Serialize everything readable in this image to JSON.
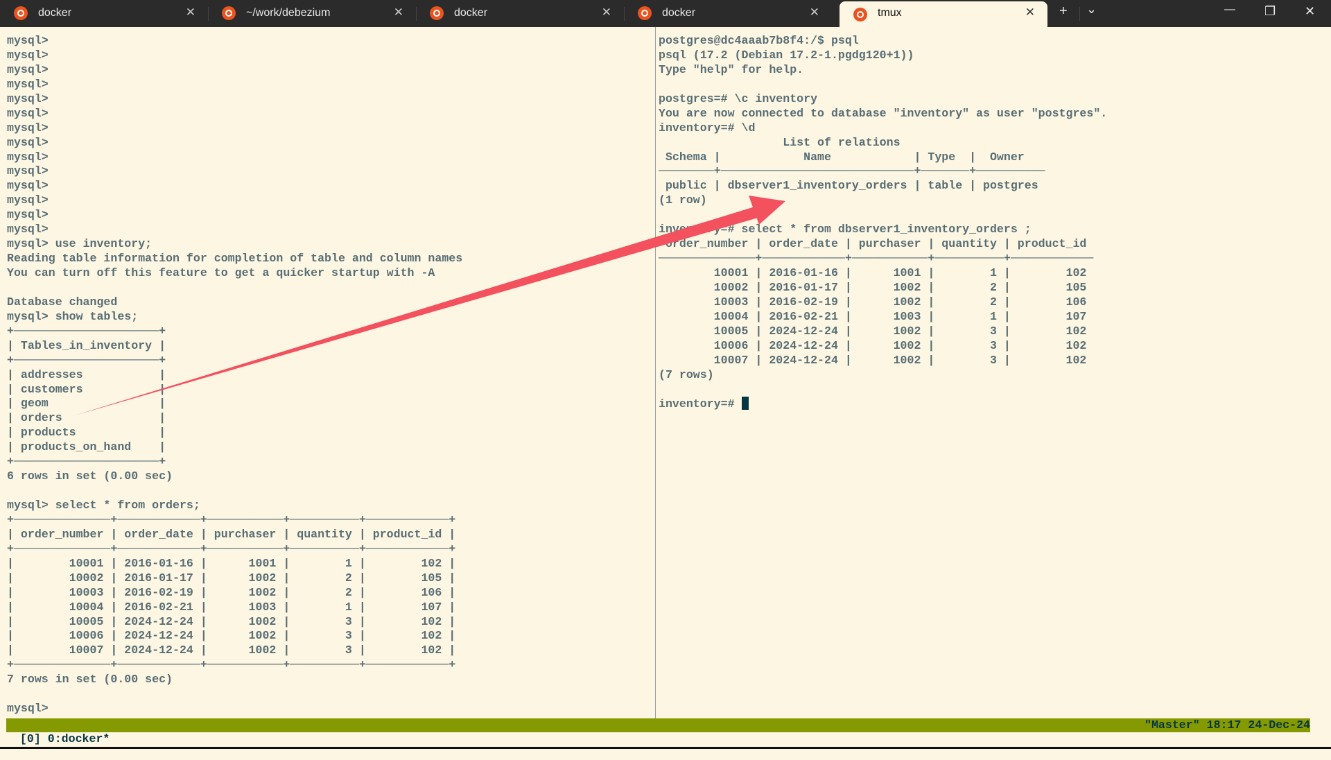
{
  "tabs": [
    {
      "label": "docker",
      "icon": "ubuntu-icon",
      "active": false
    },
    {
      "label": "~/work/debezium",
      "icon": "ubuntu-icon",
      "active": false
    },
    {
      "label": "docker",
      "icon": "ubuntu-icon",
      "active": false
    },
    {
      "label": "docker",
      "icon": "ubuntu-icon",
      "active": false
    },
    {
      "label": "tmux",
      "icon": "ubuntu-icon",
      "active": true
    }
  ],
  "tabbar": {
    "new_tab": "+",
    "dropdown": "⌄",
    "minimize": "—",
    "restore": "❐",
    "close": "✕",
    "tab_close": "✕"
  },
  "colors": {
    "background": "#fdf6e3",
    "text": "#586e75",
    "status_bar": "#859900",
    "arrow": "#f4515f"
  },
  "left_pane": {
    "lines": [
      "mysql>",
      "mysql>",
      "mysql>",
      "mysql>",
      "mysql>",
      "mysql>",
      "mysql>",
      "mysql>",
      "mysql>",
      "mysql>",
      "mysql>",
      "mysql>",
      "mysql>",
      "mysql>",
      "mysql> use inventory;",
      "Reading table information for completion of table and column names",
      "You can turn off this feature to get a quicker startup with -A",
      "",
      "Database changed",
      "mysql> show tables;",
      "+─────────────────────+",
      "| Tables_in_inventory |",
      "+─────────────────────+",
      "| addresses           |",
      "| customers           |",
      "| geom                |",
      "| orders              |",
      "| products            |",
      "| products_on_hand    |",
      "+─────────────────────+",
      "6 rows in set (0.00 sec)",
      "",
      "mysql> select * from orders;",
      "+──────────────+────────────+───────────+──────────+────────────+",
      "| order_number | order_date | purchaser | quantity | product_id |",
      "+──────────────+────────────+───────────+──────────+────────────+",
      "|        10001 | 2016-01-16 |      1001 |        1 |        102 |",
      "|        10002 | 2016-01-17 |      1002 |        2 |        105 |",
      "|        10003 | 2016-02-19 |      1002 |        2 |        106 |",
      "|        10004 | 2016-02-21 |      1003 |        1 |        107 |",
      "|        10005 | 2024-12-24 |      1002 |        3 |        102 |",
      "|        10006 | 2024-12-24 |      1002 |        3 |        102 |",
      "|        10007 | 2024-12-24 |      1002 |        3 |        102 |",
      "+──────────────+────────────+───────────+──────────+────────────+",
      "7 rows in set (0.00 sec)",
      "",
      "mysql>"
    ]
  },
  "right_pane": {
    "lines": [
      "postgres@dc4aaab7b8f4:/$ psql",
      "psql (17.2 (Debian 17.2-1.pgdg120+1))",
      "Type \"help\" for help.",
      "",
      "postgres=# \\c inventory",
      "You are now connected to database \"inventory\" as user \"postgres\".",
      "inventory=# \\d",
      "                  List of relations",
      " Schema |            Name            | Type  |  Owner",
      "────────+────────────────────────────+───────+──────────",
      " public | dbserver1_inventory_orders | table | postgres",
      "(1 row)",
      "",
      "inventory=# select * from dbserver1_inventory_orders ;",
      " order_number | order_date | purchaser | quantity | product_id",
      "──────────────+────────────+───────────+──────────+────────────",
      "        10001 | 2016-01-16 |      1001 |        1 |        102",
      "        10002 | 2016-01-17 |      1002 |        2 |        105",
      "        10003 | 2016-02-19 |      1002 |        2 |        106",
      "        10004 | 2016-02-21 |      1003 |        1 |        107",
      "        10005 | 2024-12-24 |      1002 |        3 |        102",
      "        10006 | 2024-12-24 |      1002 |        3 |        102",
      "        10007 | 2024-12-24 |      1002 |        3 |        102",
      "(7 rows)",
      ""
    ],
    "prompt": "inventory=# "
  },
  "status_bar": {
    "left": "[0] 0:docker*",
    "right": "\"Master\" 18:17 24-Dec-24"
  }
}
